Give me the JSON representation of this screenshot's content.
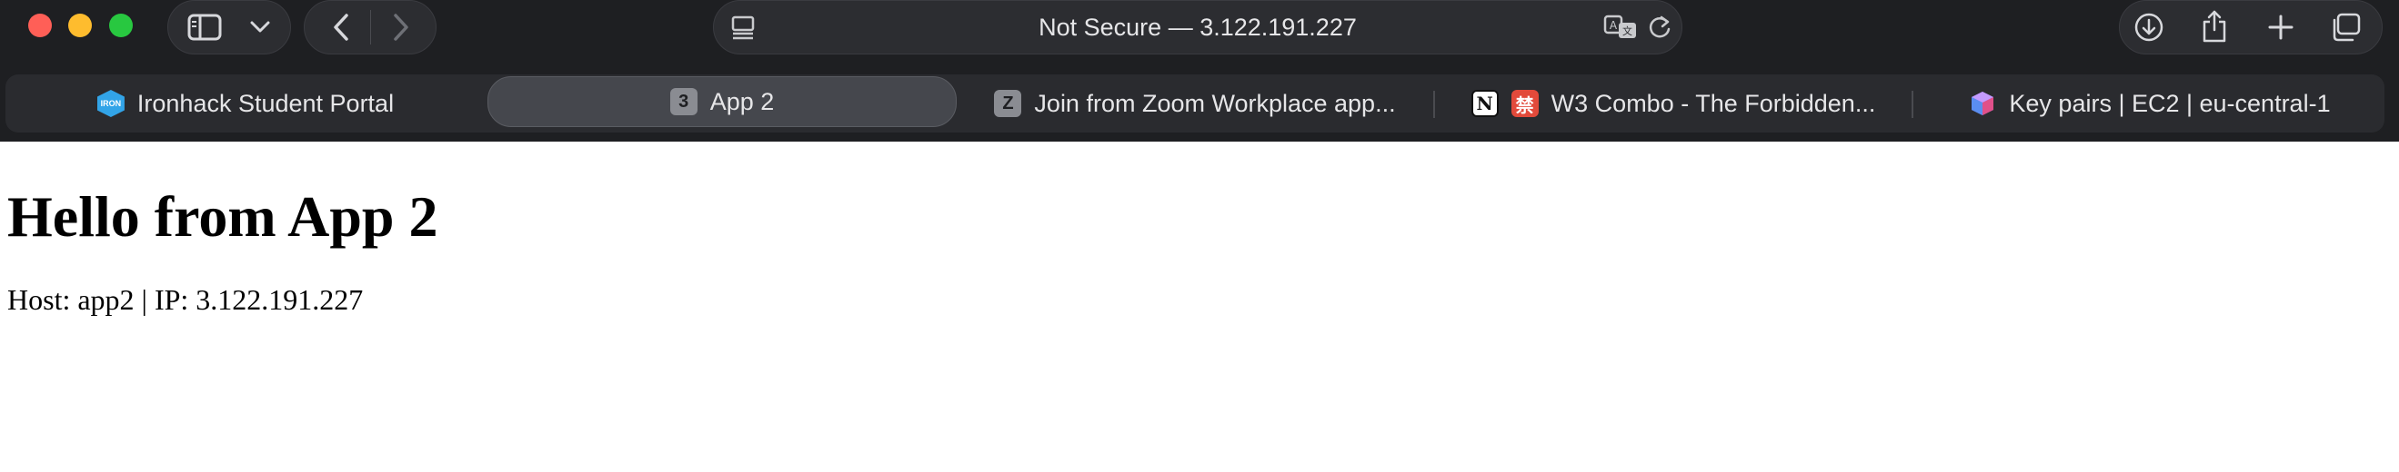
{
  "browser": {
    "address": "Not Secure — 3.122.191.227",
    "icons": {
      "sidebar": "sidebar-icon",
      "sidebar_menu": "chevron-down-icon",
      "back": "chevron-left-icon",
      "forward": "chevron-right-icon",
      "page_menu": "page-menu-icon",
      "translate": "translate-icon",
      "reload": "reload-icon",
      "downloads": "download-icon",
      "share": "share-icon",
      "new_tab": "plus-icon",
      "tab_overview": "tab-overview-icon"
    },
    "colors": {
      "chrome_bg": "#1e1f22",
      "tab_active": "#45474d",
      "close": "#ff5f57",
      "minimize": "#febc2e",
      "maximize": "#28c840"
    }
  },
  "tabs": [
    {
      "label": "Ironhack Student Portal",
      "favicon": "ironhack-favicon",
      "active": false
    },
    {
      "label": "App 2",
      "favicon_text": "3",
      "active": true
    },
    {
      "label": "Join from Zoom Workplace app...",
      "favicon_text": "Z",
      "active": false
    },
    {
      "label": "W3 Combo - The Forbidden...",
      "favicon_text": "N",
      "favicon2_text": "禁",
      "active": false
    },
    {
      "label": "Key pairs | EC2 | eu-central-1",
      "favicon": "aws-cube-favicon",
      "active": false
    }
  ],
  "page": {
    "title": "Hello from App 2",
    "info": "Host: app2 | IP: 3.122.191.227"
  }
}
